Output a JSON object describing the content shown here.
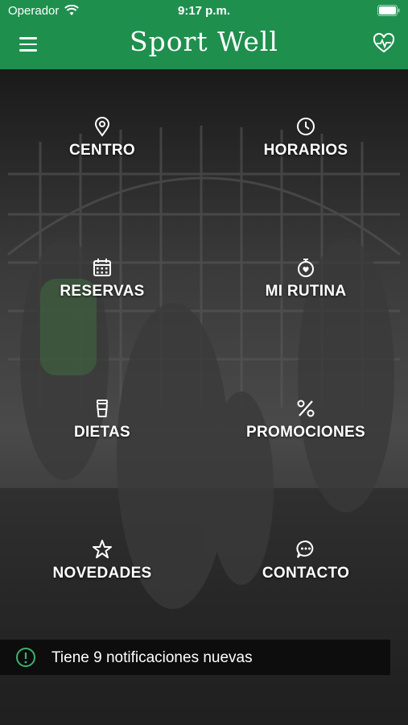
{
  "status_bar": {
    "carrier": "Operador",
    "time": "9:17 p.m."
  },
  "header": {
    "title": "Sport Well",
    "menu_icon": "hamburger-menu-icon",
    "action_icon": "heart-pulse-icon"
  },
  "colors": {
    "header_bg": "#1f8f4e",
    "accent": "#3cb371",
    "notice_bg": "#0d0d0d"
  },
  "menu": [
    {
      "label": "CENTRO",
      "icon": "location-pin-icon"
    },
    {
      "label": "HORARIOS",
      "icon": "clock-icon"
    },
    {
      "label": "RESERVAS",
      "icon": "calendar-icon"
    },
    {
      "label": "MI RUTINA",
      "icon": "stopwatch-heart-icon"
    },
    {
      "label": "DIETAS",
      "icon": "cup-icon"
    },
    {
      "label": "PROMOCIONES",
      "icon": "percent-icon"
    },
    {
      "label": "NOVEDADES",
      "icon": "star-icon"
    },
    {
      "label": "CONTACTO",
      "icon": "chat-bubble-icon"
    }
  ],
  "notification": {
    "text": "Tiene 9 notificaciones nuevas",
    "icon": "alert-circle-icon"
  }
}
